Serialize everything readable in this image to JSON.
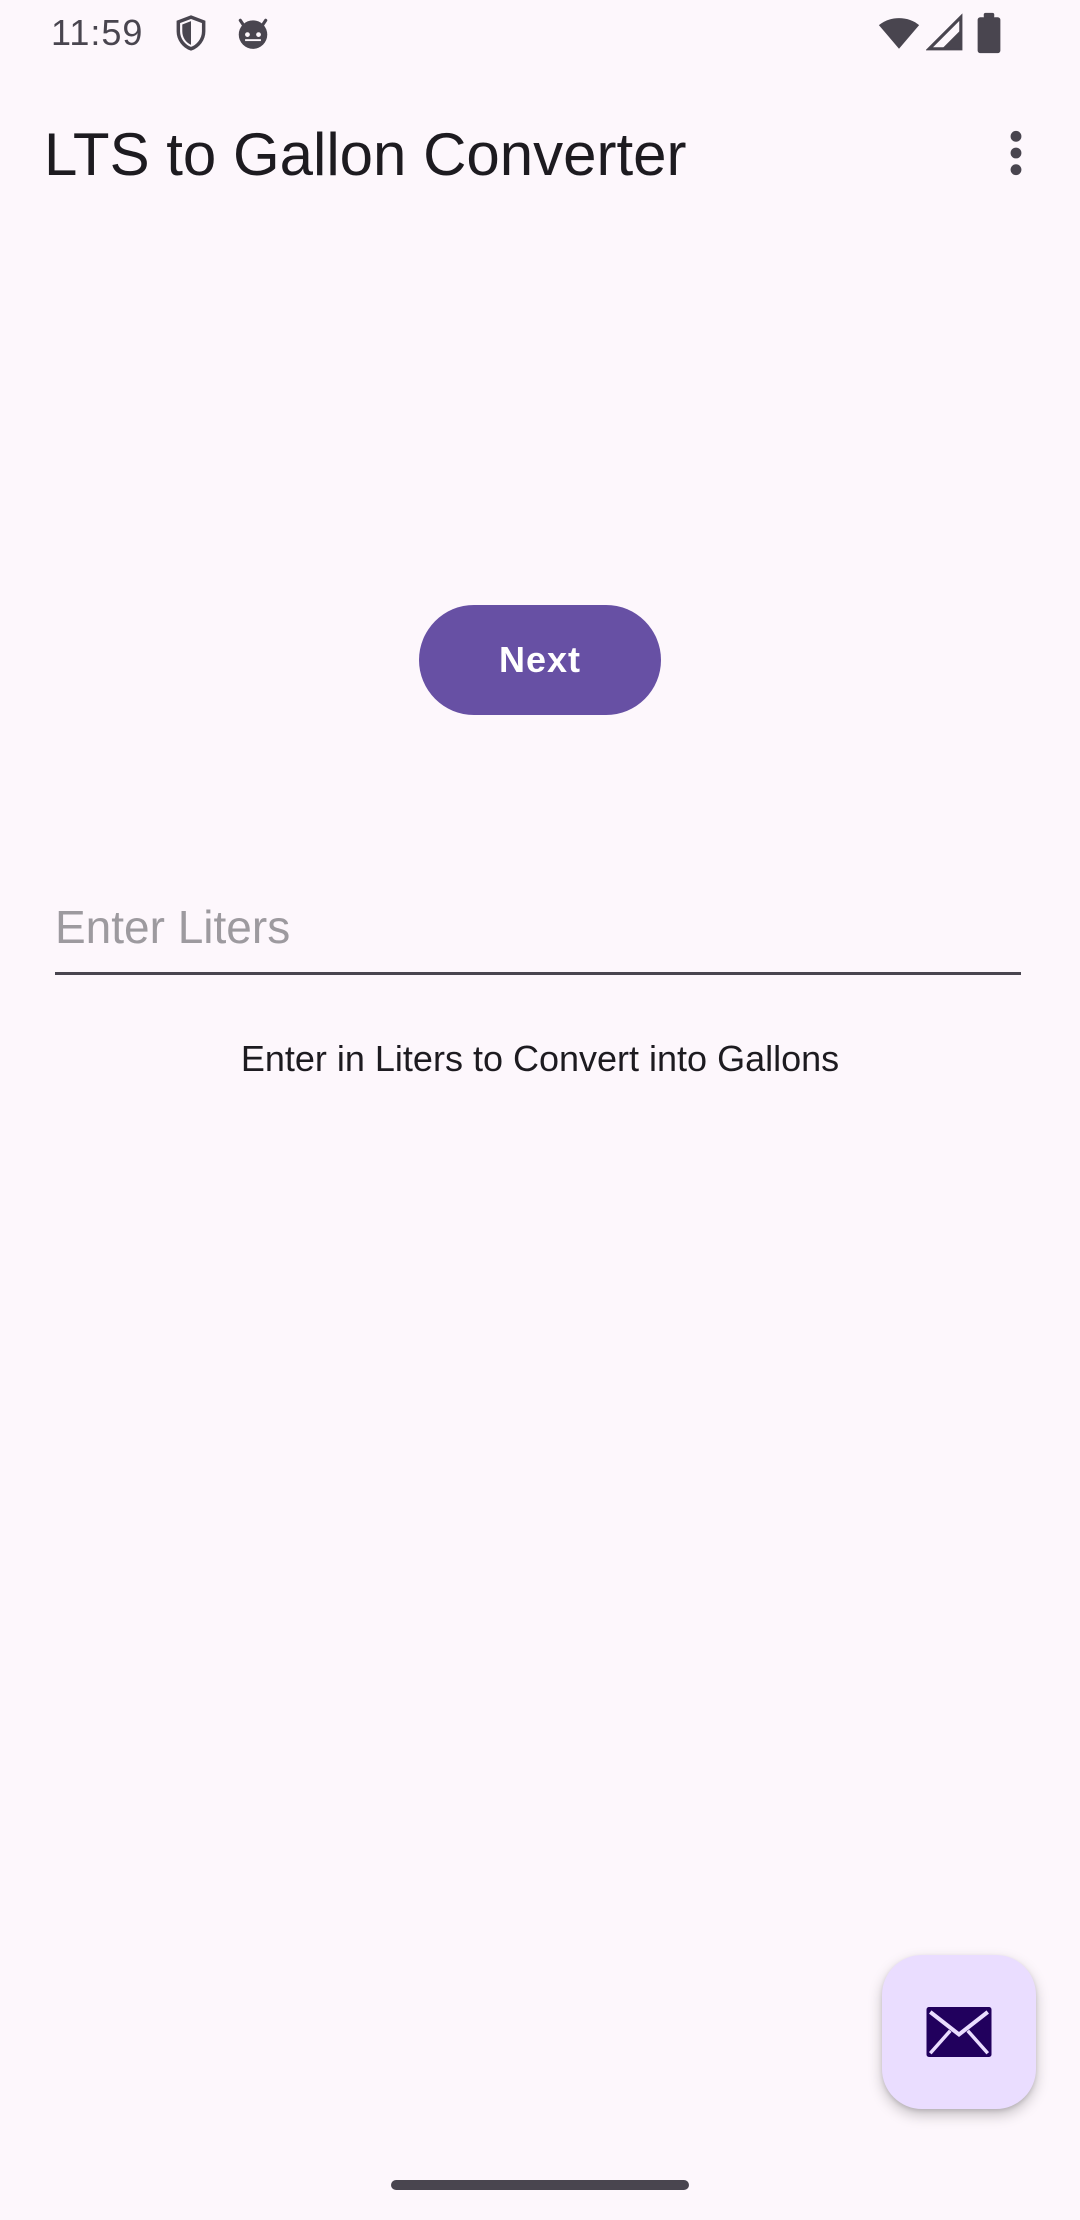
{
  "status_bar": {
    "time": "11:59",
    "icons": [
      "shield-icon",
      "android-face-icon",
      "wifi-icon",
      "signal-icon",
      "battery-icon"
    ]
  },
  "app_bar": {
    "title": "LTS to Gallon Converter",
    "overflow_icon": "more-vert-icon"
  },
  "main": {
    "next_button_label": "Next",
    "liters_input": {
      "value": "",
      "placeholder": "Enter Liters"
    },
    "helper_text": "Enter in Liters to Convert into Gallons"
  },
  "fab": {
    "icon": "mail-icon"
  },
  "colors": {
    "background": "#fdf7fc",
    "primary": "#6750a4",
    "fab_container": "#eaddff",
    "on_fab": "#21005d"
  }
}
